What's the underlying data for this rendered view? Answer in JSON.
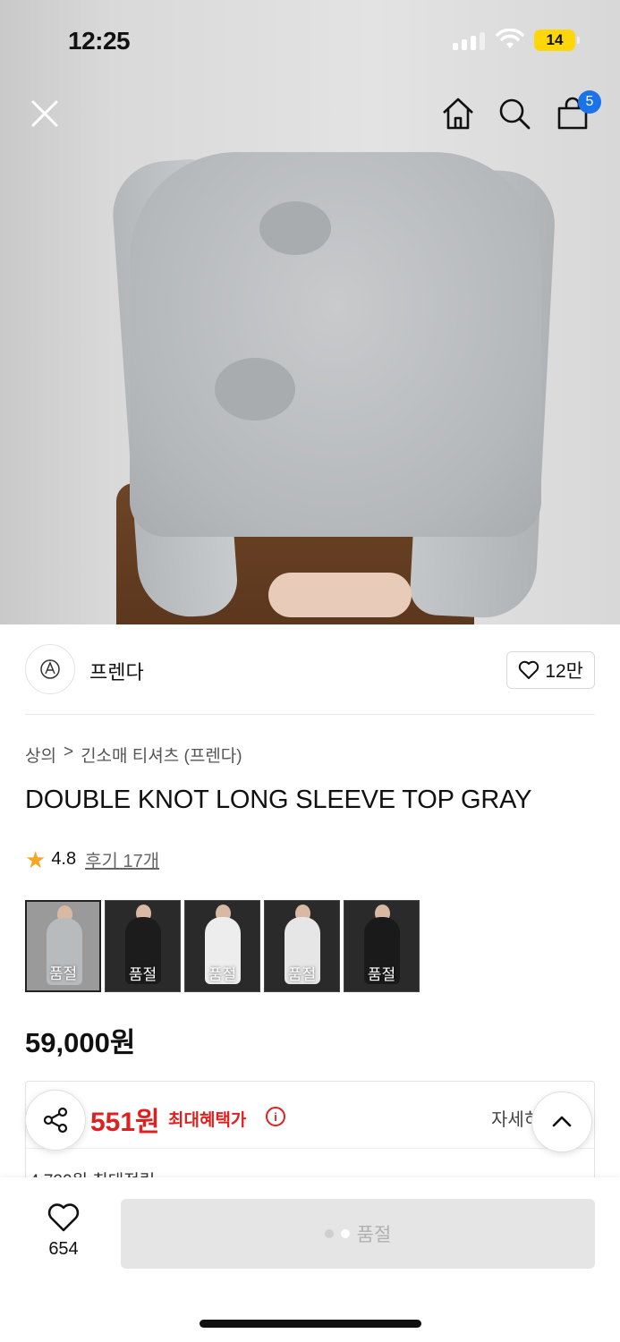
{
  "status_bar": {
    "time": "12:25",
    "battery": "14"
  },
  "nav": {
    "close_icon": "close-icon",
    "home_icon": "home-icon",
    "search_icon": "search-icon",
    "cart_icon": "cart-icon",
    "cart_count": "5"
  },
  "product": {
    "brand": "프렌다",
    "brand_likes": "12만",
    "breadcrumb": [
      "상의",
      ">",
      "긴소매 티셔츠 (프렌다)"
    ],
    "title": "DOUBLE KNOT LONG SLEEVE TOP GRAY",
    "rating": "4.8",
    "review_label": "후기 17개",
    "price": "59,000원",
    "swatches": [
      {
        "label": "품절",
        "color": "#b8bbbe"
      },
      {
        "label": "품절",
        "color": "#1c1c1c"
      },
      {
        "label": "품절",
        "color": "#ededed"
      },
      {
        "label": "품절",
        "color": "#e6e6e6"
      },
      {
        "label": "품절",
        "color": "#1a1a1a"
      }
    ]
  },
  "benefit": {
    "max_benefit_price": "551원",
    "max_benefit_label": "최대혜택가",
    "detail_link": "자세히",
    "sub_text": "4,720원 최대적립"
  },
  "bottom_bar": {
    "wish_count": "654",
    "buy_label": "품절"
  },
  "colors": {
    "accent_red": "#e02020",
    "badge_blue": "#1a73e8",
    "star": "#f5a623"
  }
}
